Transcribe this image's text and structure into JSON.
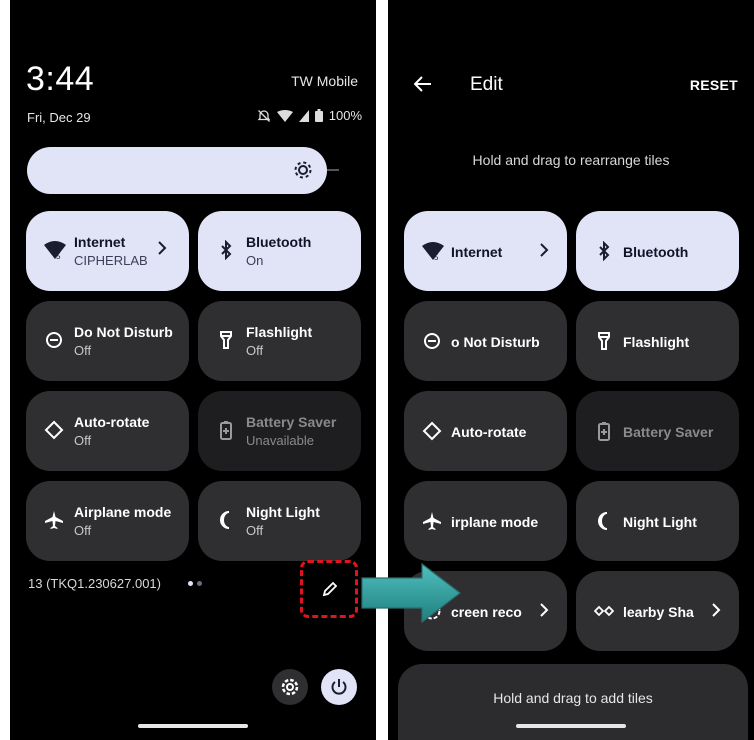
{
  "left": {
    "clock": "3:44",
    "carrier": "TW Mobile",
    "date": "Fri, Dec 29",
    "battery": "100%",
    "tiles": [
      {
        "title": "Internet",
        "subtitle": "CIPHERLAB",
        "icon": "wifi-icon",
        "active": true,
        "chevron": true
      },
      {
        "title": "Bluetooth",
        "subtitle": "On",
        "icon": "bluetooth-icon",
        "active": true
      },
      {
        "title": "Do Not Disturb",
        "subtitle": "Off",
        "icon": "do-not-disturb-icon"
      },
      {
        "title": "Flashlight",
        "subtitle": "Off",
        "icon": "flashlight-icon"
      },
      {
        "title": "Auto-rotate",
        "subtitle": "Off",
        "icon": "auto-rotate-icon"
      },
      {
        "title": "Battery Saver",
        "subtitle": "Unavailable",
        "icon": "battery-saver-icon",
        "dim": true
      },
      {
        "title": "Airplane mode",
        "subtitle": "Off",
        "icon": "airplane-icon"
      },
      {
        "title": "Night Light",
        "subtitle": "Off",
        "icon": "night-light-icon"
      }
    ],
    "build": "13 (TKQ1.230627.001)"
  },
  "right": {
    "title": "Edit",
    "reset": "RESET",
    "hint_top": "Hold and drag to rearrange tiles",
    "tiles": [
      {
        "title": "Internet",
        "icon": "wifi-icon",
        "active": true,
        "chevron": true
      },
      {
        "title": "Bluetooth",
        "icon": "bluetooth-icon",
        "active": true
      },
      {
        "title": "o Not Disturb",
        "icon": "do-not-disturb-icon"
      },
      {
        "title": "Flashlight",
        "icon": "flashlight-icon"
      },
      {
        "title": "Auto-rotate",
        "icon": "auto-rotate-icon"
      },
      {
        "title": "Battery Saver",
        "icon": "battery-saver-icon",
        "dim": true
      },
      {
        "title": "irplane mode",
        "icon": "airplane-icon"
      },
      {
        "title": "Night Light",
        "icon": "night-light-icon"
      },
      {
        "title": "creen reco",
        "icon": "screen-record-icon",
        "chevron": true
      },
      {
        "title": "learby Sha",
        "icon": "nearby-share-icon",
        "chevron": true
      }
    ],
    "hint_bottom": "Hold and drag to add tiles"
  },
  "colors": {
    "tile_active": "#e1e3f7",
    "tile_inactive": "#2f2f31",
    "highlight_dash": "#e0141c",
    "arrow_fill": "#2f9a99"
  }
}
